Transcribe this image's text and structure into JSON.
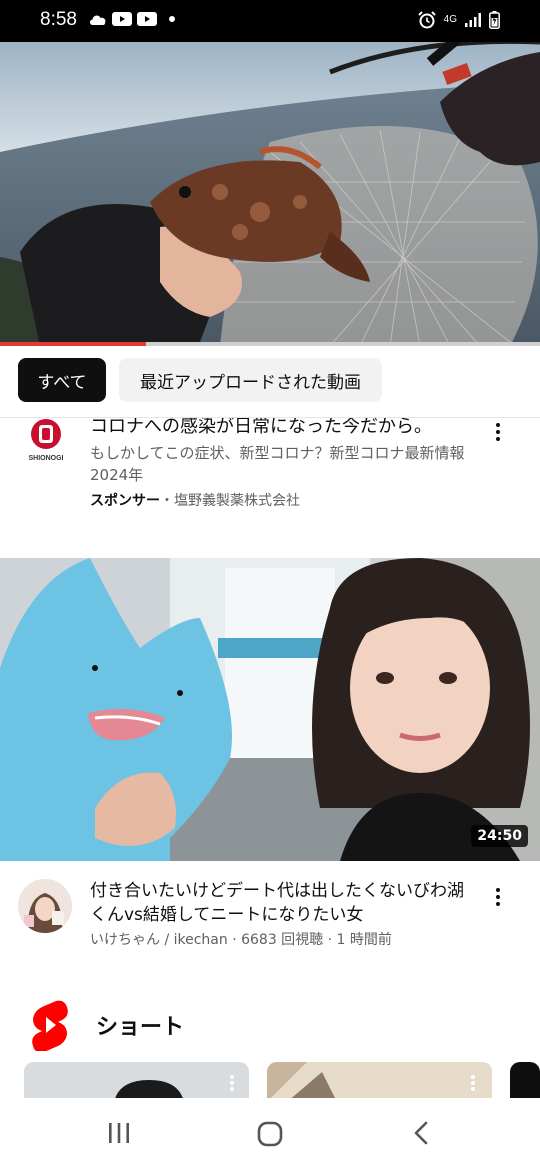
{
  "status_bar": {
    "time": "8:58",
    "left_icons": [
      "cloud-icon",
      "youtube-icon",
      "youtube-icon",
      "dot-icon"
    ],
    "right_icons": [
      "alarm-icon",
      "4g-icon",
      "signal-icon",
      "battery-icon"
    ],
    "network": "4G"
  },
  "player": {
    "progress_fraction": 0.27,
    "accent": "#e53935"
  },
  "filter_chips": [
    {
      "label": "すべて",
      "selected": true
    },
    {
      "label": "最近アップロードされた動画",
      "selected": false
    }
  ],
  "ad": {
    "advertiser_logo_text": "SHIONOGI",
    "title": "コロナへの感染が日常になった今だから。",
    "description": "もしかしてこの症状、新型コロナ？新型コロナ最新情報2024年",
    "sponsor_label": "スポンサー",
    "separator": "・",
    "advertiser": "塩野義製薬株式会社"
  },
  "video": {
    "duration": "24:50",
    "title": "付き合いたいけどデート代は出したくないびわ湖くんvs結婚してニートになりたい女",
    "meta": "いけちゃん / ikechan · 6683 回視聴 · 1 時間前"
  },
  "shorts": {
    "label": "ショート"
  },
  "navbar": {
    "icons": [
      "recent-apps-icon",
      "home-icon",
      "back-icon"
    ]
  }
}
